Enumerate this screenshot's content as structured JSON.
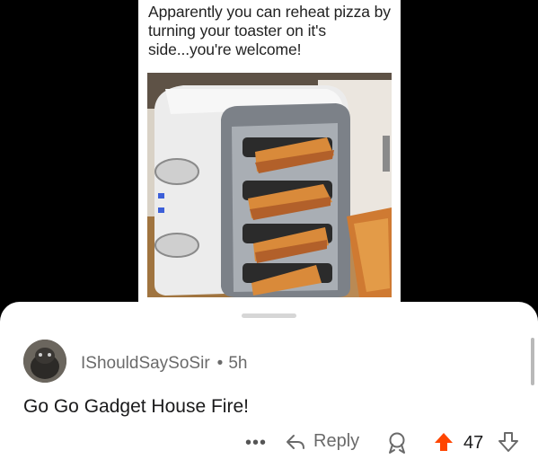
{
  "post": {
    "caption": "Apparently you can reheat pizza by turning your toaster on it's side...you're welcome!"
  },
  "comment": {
    "username": "IShouldSaySoSir",
    "separator": "•",
    "age": "5h",
    "body": "Go Go Gadget House Fire!",
    "actions": {
      "more_label": "•••",
      "reply_label": "Reply",
      "vote_count": "47"
    }
  },
  "colors": {
    "upvote_active": "#ff4500",
    "text_primary": "#1a1a1b",
    "text_secondary": "#6a6a6a"
  },
  "icons": [
    "more-icon",
    "reply-arrow-icon",
    "award-icon",
    "upvote-arrow-icon",
    "downvote-arrow-icon"
  ]
}
